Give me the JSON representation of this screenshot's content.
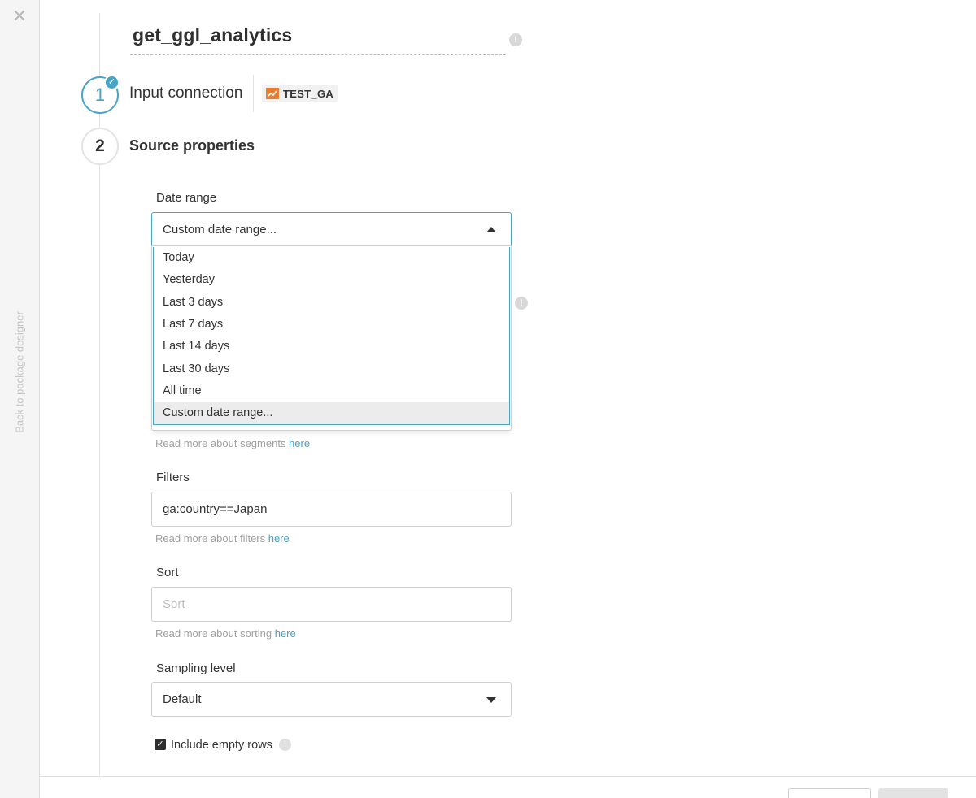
{
  "rail": {
    "close_glyph": "✕",
    "back_label": "Back to package designer"
  },
  "header": {
    "title": "get_ggl_analytics"
  },
  "steps": [
    {
      "number": "1",
      "label": "Input connection",
      "completed": true,
      "connection": {
        "icon": "chart-line-icon",
        "name": "TEST_GA",
        "color": "#e87c2f"
      }
    },
    {
      "number": "2",
      "label": "Source properties"
    }
  ],
  "fields": {
    "date_range": {
      "label": "Date range",
      "value": "Custom date range...",
      "options": [
        "Today",
        "Yesterday",
        "Last 3 days",
        "Last 7 days",
        "Last 14 days",
        "Last 30 days",
        "All time",
        "Custom date range..."
      ],
      "selected_index": 7
    },
    "segments": {
      "helper_text": "Read more about segments ",
      "helper_link": "here"
    },
    "filters": {
      "label": "Filters",
      "value": "ga:country==Japan",
      "helper_text": "Read more about filters ",
      "helper_link": "here"
    },
    "sort": {
      "label": "Sort",
      "placeholder": "Sort",
      "helper_text": "Read more about sorting ",
      "helper_link": "here"
    },
    "sampling_level": {
      "label": "Sampling level",
      "value": "Default"
    },
    "include_empty_rows": {
      "label": "Include empty rows",
      "checked": true
    }
  },
  "colors": {
    "accent": "#47a3c8",
    "text": "#333333",
    "helper": "#a0a0a0"
  }
}
